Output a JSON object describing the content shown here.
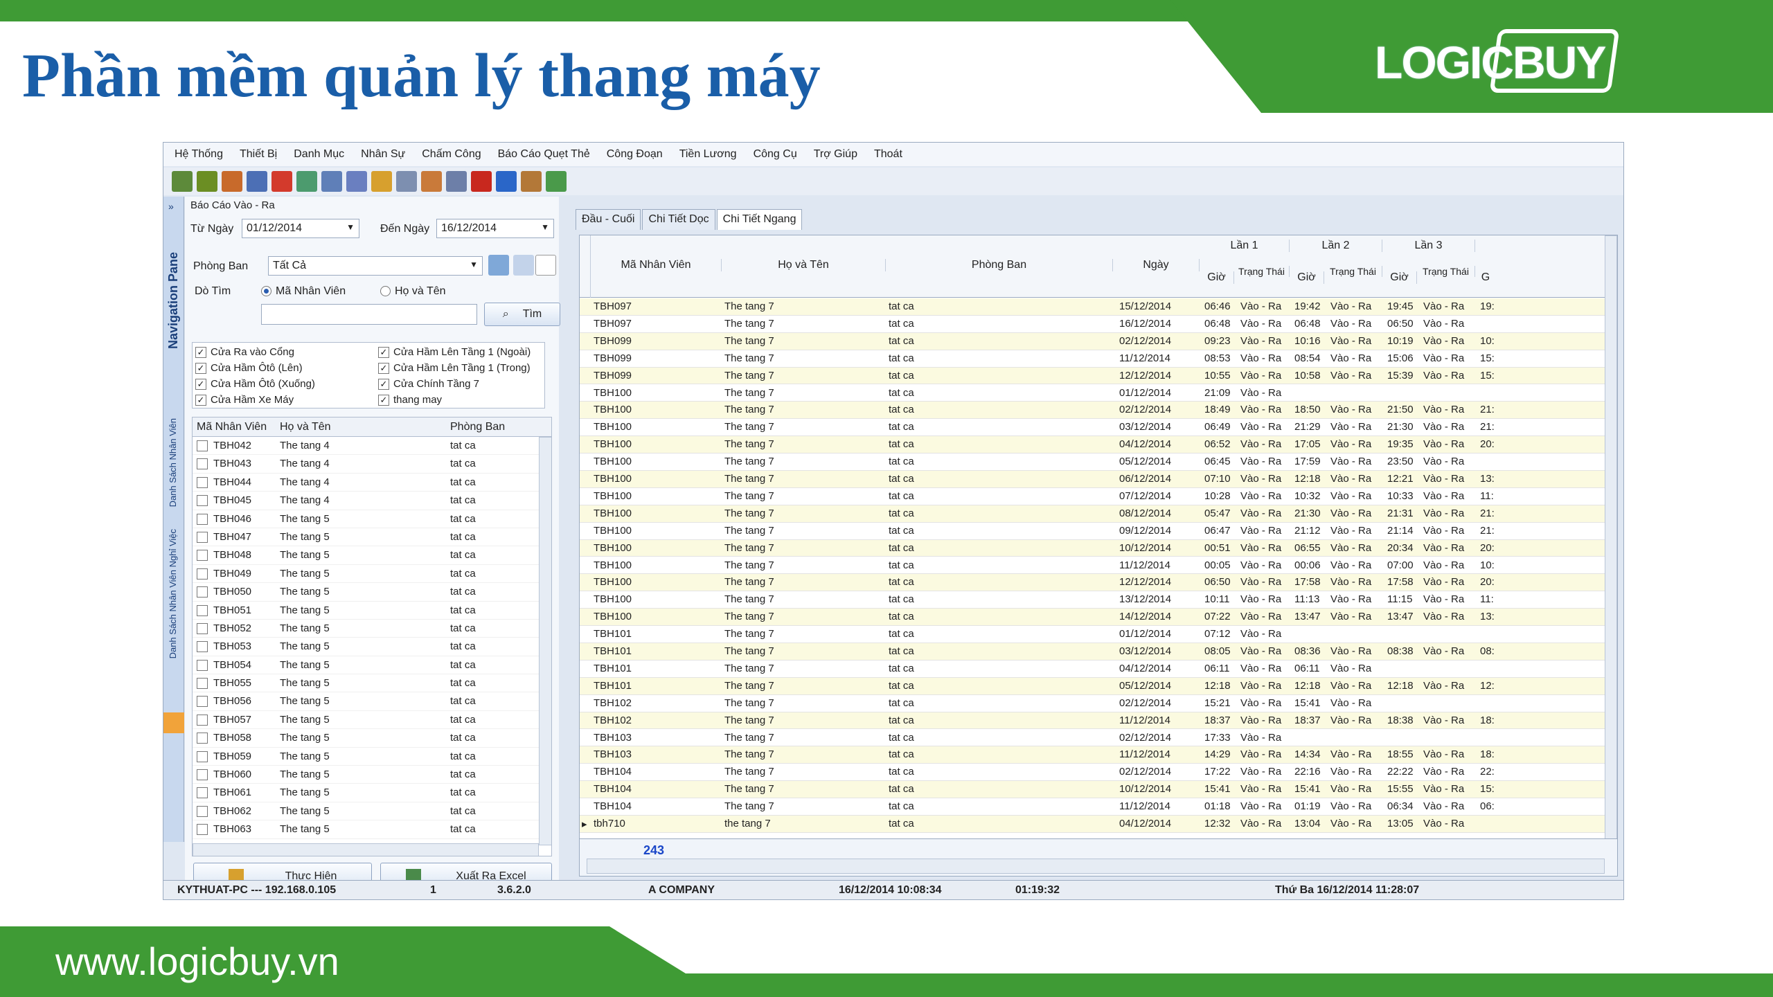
{
  "slide": {
    "title": "Phần mềm quản lý thang máy",
    "brand": "LOGICBUY",
    "website": "www.logicbuy.vn"
  },
  "menu": [
    "Hệ Thống",
    "Thiết Bị",
    "Danh Mục",
    "Nhân Sự",
    "Chấm Công",
    "Báo Cáo Quẹt Thẻ",
    "Công Đoạn",
    "Tiền Lương",
    "Công Cụ",
    "Trợ Giúp",
    "Thoát"
  ],
  "nav": {
    "pane_label": "Navigation Pane",
    "side_labels": [
      "Danh Sách Nhân Viên",
      "Danh Sách Nhân Viên Nghỉ Việc"
    ]
  },
  "report": {
    "caption": "Báo Cáo Vào - Ra",
    "from_label": "Từ Ngày",
    "from_value": "01/12/2014",
    "to_label": "Đến Ngày",
    "to_value": "16/12/2014",
    "dept_label": "Phòng Ban",
    "dept_value": "Tất Cả",
    "search_label": "Dò Tìm",
    "radio_code": "Mã Nhân Viên",
    "radio_name": "Họ và Tên",
    "find_button": "Tìm",
    "filters": [
      "Cửa Ra vào Cổng",
      "Cửa Hầm Ôtô (Lên)",
      "Cửa Hầm Ôtô (Xuống)",
      "Cửa Hầm Xe Máy",
      "Cửa Hầm Lên Tầng 1 (Ngoài)",
      "Cửa Hầm Lên Tầng 1 (Trong)",
      "Cửa Chính Tầng 7",
      "thang may"
    ],
    "emp_headers": [
      "Mã Nhân Viên",
      "Họ và Tên",
      "Phòng Ban"
    ],
    "employees": [
      [
        "TBH042",
        "The tang 4",
        "tat ca"
      ],
      [
        "TBH043",
        "The tang 4",
        "tat ca"
      ],
      [
        "TBH044",
        "The tang 4",
        "tat ca"
      ],
      [
        "TBH045",
        "The tang 4",
        "tat ca"
      ],
      [
        "TBH046",
        "The tang 5",
        "tat ca"
      ],
      [
        "TBH047",
        "The tang 5",
        "tat ca"
      ],
      [
        "TBH048",
        "The tang 5",
        "tat ca"
      ],
      [
        "TBH049",
        "The tang 5",
        "tat ca"
      ],
      [
        "TBH050",
        "The tang 5",
        "tat ca"
      ],
      [
        "TBH051",
        "The tang 5",
        "tat ca"
      ],
      [
        "TBH052",
        "The tang 5",
        "tat ca"
      ],
      [
        "TBH053",
        "The tang 5",
        "tat ca"
      ],
      [
        "TBH054",
        "The tang 5",
        "tat ca"
      ],
      [
        "TBH055",
        "The tang 5",
        "tat ca"
      ],
      [
        "TBH056",
        "The tang 5",
        "tat ca"
      ],
      [
        "TBH057",
        "The tang 5",
        "tat ca"
      ],
      [
        "TBH058",
        "The tang 5",
        "tat ca"
      ],
      [
        "TBH059",
        "The tang 5",
        "tat ca"
      ],
      [
        "TBH060",
        "The tang 5",
        "tat ca"
      ],
      [
        "TBH061",
        "The tang 5",
        "tat ca"
      ],
      [
        "TBH062",
        "The tang 5",
        "tat ca"
      ],
      [
        "TBH063",
        "The tang 5",
        "tat ca"
      ]
    ],
    "run_button": "Thực Hiện",
    "export_button": "Xuất Ra Excel"
  },
  "tabs": [
    "Đầu - Cuối",
    "Chi Tiết Dọc",
    "Chi Tiết Ngang"
  ],
  "grid": {
    "headers": {
      "code": "Mã Nhân Viên",
      "name": "Họ và Tên",
      "dept": "Phòng Ban",
      "date": "Ngày",
      "lan1": "Lần 1",
      "lan2": "Lần 2",
      "lan3": "Lần 3",
      "gio": "Giờ",
      "trang_thai": "Trạng Thái",
      "g": "G"
    },
    "rows": [
      [
        "TBH097",
        "The tang 7",
        "tat ca",
        "15/12/2014",
        "06:46",
        "Vào - Ra",
        "19:42",
        "Vào - Ra",
        "19:45",
        "Vào - Ra",
        "19:"
      ],
      [
        "TBH097",
        "The tang 7",
        "tat ca",
        "16/12/2014",
        "06:48",
        "Vào - Ra",
        "06:48",
        "Vào - Ra",
        "06:50",
        "Vào - Ra",
        ""
      ],
      [
        "TBH099",
        "The tang 7",
        "tat ca",
        "02/12/2014",
        "09:23",
        "Vào - Ra",
        "10:16",
        "Vào - Ra",
        "10:19",
        "Vào - Ra",
        "10:"
      ],
      [
        "TBH099",
        "The tang 7",
        "tat ca",
        "11/12/2014",
        "08:53",
        "Vào - Ra",
        "08:54",
        "Vào - Ra",
        "15:06",
        "Vào - Ra",
        "15:"
      ],
      [
        "TBH099",
        "The tang 7",
        "tat ca",
        "12/12/2014",
        "10:55",
        "Vào - Ra",
        "10:58",
        "Vào - Ra",
        "15:39",
        "Vào - Ra",
        "15:"
      ],
      [
        "TBH100",
        "The tang 7",
        "tat ca",
        "01/12/2014",
        "21:09",
        "Vào - Ra",
        "",
        "",
        "",
        "",
        ""
      ],
      [
        "TBH100",
        "The tang 7",
        "tat ca",
        "02/12/2014",
        "18:49",
        "Vào - Ra",
        "18:50",
        "Vào - Ra",
        "21:50",
        "Vào - Ra",
        "21:"
      ],
      [
        "TBH100",
        "The tang 7",
        "tat ca",
        "03/12/2014",
        "06:49",
        "Vào - Ra",
        "21:29",
        "Vào - Ra",
        "21:30",
        "Vào - Ra",
        "21:"
      ],
      [
        "TBH100",
        "The tang 7",
        "tat ca",
        "04/12/2014",
        "06:52",
        "Vào - Ra",
        "17:05",
        "Vào - Ra",
        "19:35",
        "Vào - Ra",
        "20:"
      ],
      [
        "TBH100",
        "The tang 7",
        "tat ca",
        "05/12/2014",
        "06:45",
        "Vào - Ra",
        "17:59",
        "Vào - Ra",
        "23:50",
        "Vào - Ra",
        ""
      ],
      [
        "TBH100",
        "The tang 7",
        "tat ca",
        "06/12/2014",
        "07:10",
        "Vào - Ra",
        "12:18",
        "Vào - Ra",
        "12:21",
        "Vào - Ra",
        "13:"
      ],
      [
        "TBH100",
        "The tang 7",
        "tat ca",
        "07/12/2014",
        "10:28",
        "Vào - Ra",
        "10:32",
        "Vào - Ra",
        "10:33",
        "Vào - Ra",
        "11:"
      ],
      [
        "TBH100",
        "The tang 7",
        "tat ca",
        "08/12/2014",
        "05:47",
        "Vào - Ra",
        "21:30",
        "Vào - Ra",
        "21:31",
        "Vào - Ra",
        "21:"
      ],
      [
        "TBH100",
        "The tang 7",
        "tat ca",
        "09/12/2014",
        "06:47",
        "Vào - Ra",
        "21:12",
        "Vào - Ra",
        "21:14",
        "Vào - Ra",
        "21:"
      ],
      [
        "TBH100",
        "The tang 7",
        "tat ca",
        "10/12/2014",
        "00:51",
        "Vào - Ra",
        "06:55",
        "Vào - Ra",
        "20:34",
        "Vào - Ra",
        "20:"
      ],
      [
        "TBH100",
        "The tang 7",
        "tat ca",
        "11/12/2014",
        "00:05",
        "Vào - Ra",
        "00:06",
        "Vào - Ra",
        "07:00",
        "Vào - Ra",
        "10:"
      ],
      [
        "TBH100",
        "The tang 7",
        "tat ca",
        "12/12/2014",
        "06:50",
        "Vào - Ra",
        "17:58",
        "Vào - Ra",
        "17:58",
        "Vào - Ra",
        "20:"
      ],
      [
        "TBH100",
        "The tang 7",
        "tat ca",
        "13/12/2014",
        "10:11",
        "Vào - Ra",
        "11:13",
        "Vào - Ra",
        "11:15",
        "Vào - Ra",
        "11:"
      ],
      [
        "TBH100",
        "The tang 7",
        "tat ca",
        "14/12/2014",
        "07:22",
        "Vào - Ra",
        "13:47",
        "Vào - Ra",
        "13:47",
        "Vào - Ra",
        "13:"
      ],
      [
        "TBH101",
        "The tang 7",
        "tat ca",
        "01/12/2014",
        "07:12",
        "Vào - Ra",
        "",
        "",
        "",
        "",
        ""
      ],
      [
        "TBH101",
        "The tang 7",
        "tat ca",
        "03/12/2014",
        "08:05",
        "Vào - Ra",
        "08:36",
        "Vào - Ra",
        "08:38",
        "Vào - Ra",
        "08:"
      ],
      [
        "TBH101",
        "The tang 7",
        "tat ca",
        "04/12/2014",
        "06:11",
        "Vào - Ra",
        "06:11",
        "Vào - Ra",
        "",
        "",
        ""
      ],
      [
        "TBH101",
        "The tang 7",
        "tat ca",
        "05/12/2014",
        "12:18",
        "Vào - Ra",
        "12:18",
        "Vào - Ra",
        "12:18",
        "Vào - Ra",
        "12:"
      ],
      [
        "TBH102",
        "The tang 7",
        "tat ca",
        "02/12/2014",
        "15:21",
        "Vào - Ra",
        "15:41",
        "Vào - Ra",
        "",
        "",
        ""
      ],
      [
        "TBH102",
        "The tang 7",
        "tat ca",
        "11/12/2014",
        "18:37",
        "Vào - Ra",
        "18:37",
        "Vào - Ra",
        "18:38",
        "Vào - Ra",
        "18:"
      ],
      [
        "TBH103",
        "The tang 7",
        "tat ca",
        "02/12/2014",
        "17:33",
        "Vào - Ra",
        "",
        "",
        "",
        "",
        ""
      ],
      [
        "TBH103",
        "The tang 7",
        "tat ca",
        "11/12/2014",
        "14:29",
        "Vào - Ra",
        "14:34",
        "Vào - Ra",
        "18:55",
        "Vào - Ra",
        "18:"
      ],
      [
        "TBH104",
        "The tang 7",
        "tat ca",
        "02/12/2014",
        "17:22",
        "Vào - Ra",
        "22:16",
        "Vào - Ra",
        "22:22",
        "Vào - Ra",
        "22:"
      ],
      [
        "TBH104",
        "The tang 7",
        "tat ca",
        "10/12/2014",
        "15:41",
        "Vào - Ra",
        "15:41",
        "Vào - Ra",
        "15:55",
        "Vào - Ra",
        "15:"
      ],
      [
        "TBH104",
        "The tang 7",
        "tat ca",
        "11/12/2014",
        "01:18",
        "Vào - Ra",
        "01:19",
        "Vào - Ra",
        "06:34",
        "Vào - Ra",
        "06:"
      ],
      [
        "tbh710",
        "the tang 7",
        "tat ca",
        "04/12/2014",
        "12:32",
        "Vào - Ra",
        "13:04",
        "Vào - Ra",
        "13:05",
        "Vào - Ra",
        ""
      ]
    ],
    "count": "243"
  },
  "status": {
    "machine": "KYTHUAT-PC --- 192.168.0.105",
    "num": "1",
    "version": "3.6.2.0",
    "company": "A COMPANY",
    "login_time": "16/12/2014 10:08:34",
    "elapsed": "01:19:32",
    "now": "Thứ Ba 16/12/2014 11:28:07"
  },
  "colors": {
    "brand_green": "#3f9b35",
    "title_blue": "#1a5ea8",
    "row_yellow": "#fbfae0"
  }
}
